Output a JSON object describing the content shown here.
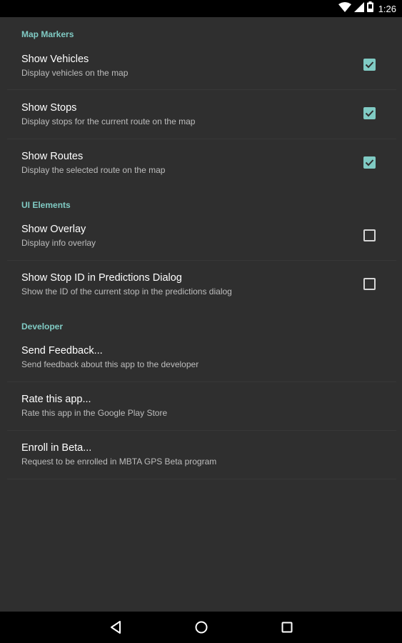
{
  "status_bar": {
    "time": "1:26",
    "icons": [
      "wifi-icon",
      "cell-signal-icon",
      "battery-icon"
    ]
  },
  "colors": {
    "background": "#2f2f2f",
    "accent": "#80cbc4",
    "title_text": "#ffffff",
    "summary_text": "#bdbdbd"
  },
  "sections": [
    {
      "label": "Map Markers",
      "items": [
        {
          "title": "Show Vehicles",
          "summary": "Display vehicles on the map",
          "checked": true
        },
        {
          "title": "Show Stops",
          "summary": "Display stops for the current route on the map",
          "checked": true
        },
        {
          "title": "Show Routes",
          "summary": "Display the selected route on the map",
          "checked": true
        }
      ]
    },
    {
      "label": "UI Elements",
      "items": [
        {
          "title": "Show Overlay",
          "summary": "Display info overlay",
          "checked": false
        },
        {
          "title": "Show Stop ID in Predictions Dialog",
          "summary": "Show the ID of the current stop in the predictions dialog",
          "checked": false
        }
      ]
    },
    {
      "label": "Developer",
      "items": [
        {
          "title": "Send Feedback...",
          "summary": "Send feedback about this app to the developer"
        },
        {
          "title": "Rate this app...",
          "summary": "Rate this app in the Google Play Store"
        },
        {
          "title": "Enroll in Beta...",
          "summary": "Request to be enrolled in MBTA GPS Beta program"
        }
      ]
    }
  ],
  "nav_bar": {
    "icons": [
      "back-icon",
      "home-icon",
      "recents-icon"
    ]
  }
}
